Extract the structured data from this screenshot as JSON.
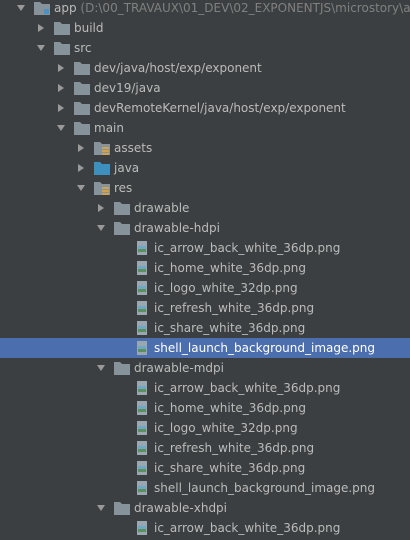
{
  "project": {
    "name": "app",
    "path": "(D:\\00_TRAVAUX\\01_DEV\\02_EXPONENTJS\\microstory\\app\\mic"
  },
  "folders": {
    "build": "build",
    "src": "src",
    "dev_java": "dev/java/host/exp/exponent",
    "dev19_java": "dev19/java",
    "devRemoteKernel": "devRemoteKernel/java/host/exp/exponent",
    "main": "main",
    "assets": "assets",
    "java": "java",
    "res": "res",
    "drawable": "drawable",
    "drawable_hdpi": "drawable-hdpi",
    "drawable_mdpi": "drawable-mdpi",
    "drawable_xhdpi": "drawable-xhdpi"
  },
  "hdpi_files": [
    "ic_arrow_back_white_36dp.png",
    "ic_home_white_36dp.png",
    "ic_logo_white_32dp.png",
    "ic_refresh_white_36dp.png",
    "ic_share_white_36dp.png",
    "shell_launch_background_image.png"
  ],
  "mdpi_files": [
    "ic_arrow_back_white_36dp.png",
    "ic_home_white_36dp.png",
    "ic_logo_white_32dp.png",
    "ic_refresh_white_36dp.png",
    "ic_share_white_36dp.png",
    "shell_launch_background_image.png"
  ],
  "xhdpi_files": [
    "ic_arrow_back_white_36dp.png"
  ],
  "colors": {
    "background": "#3c3f41",
    "selection": "#4b6eaf",
    "text": "#bbbbbb",
    "folder": "#87939a",
    "source_folder": "#3d8fbd",
    "resource_marker": "#d1a14f",
    "image_file": "#6fa8c7"
  }
}
